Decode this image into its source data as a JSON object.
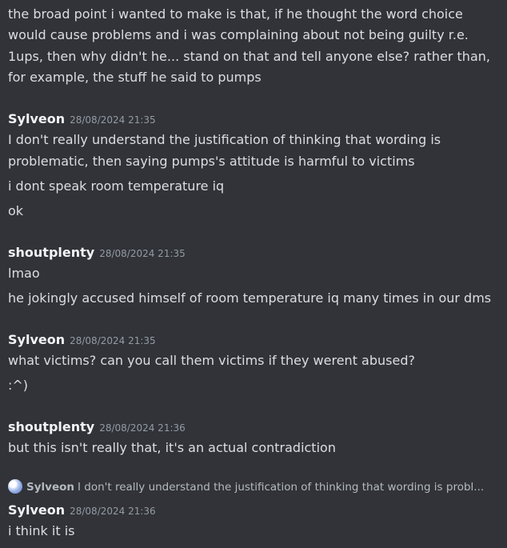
{
  "messages": [
    {
      "author": "",
      "timestamp": "",
      "lines": [
        "the broad point i wanted to make is that, if he thought the word choice",
        "would cause problems and i was complaining about not being guilty r.e.",
        "1ups, then why didn't he... stand on that and tell anyone else? rather than,",
        "for example, the stuff he said to pumps"
      ]
    },
    {
      "author": "Sylveon",
      "timestamp": "28/08/2024 21:35",
      "lines": [
        "I don't really understand the justification of thinking that wording is",
        "problematic, then saying pumps's attitude is harmful to victims",
        "i dont speak room temperature iq",
        "ok"
      ]
    },
    {
      "author": "shoutplenty",
      "timestamp": "28/08/2024 21:35",
      "lines": [
        "lmao",
        "he jokingly accused himself of room temperature iq many times in our dms"
      ]
    },
    {
      "author": "Sylveon",
      "timestamp": "28/08/2024 21:35",
      "lines": [
        "what victims? can you call them victims if they werent abused?",
        ":^)"
      ]
    },
    {
      "author": "shoutplenty",
      "timestamp": "28/08/2024 21:36",
      "lines": [
        "but this isn't really that, it's an actual contradiction"
      ]
    },
    {
      "reply": {
        "author": "Sylveon",
        "text": "I don't really understand the justification of thinking that wording is probl..."
      },
      "author": "Sylveon",
      "timestamp": "28/08/2024 21:36",
      "lines": [
        "i think it is"
      ]
    }
  ],
  "icons": {
    "reply_avatar": "sylveon-avatar-icon"
  },
  "colors": {
    "background": "#313338",
    "text": "#dbdee1",
    "author": "#f2f3f5",
    "timestamp": "#949ba4",
    "reply_text": "#b5bac1"
  }
}
